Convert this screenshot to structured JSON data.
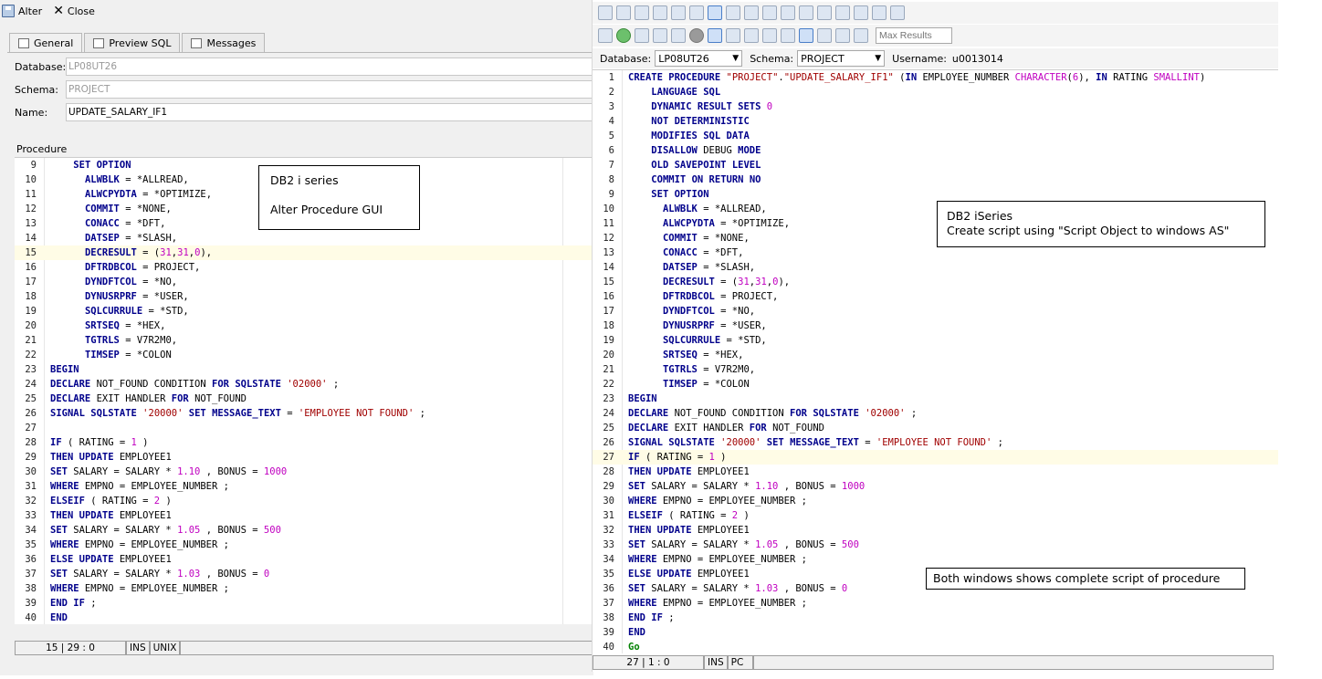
{
  "left": {
    "toolbar": {
      "alter_label": "Alter",
      "close_label": "Close"
    },
    "tabs": [
      "General",
      "Preview SQL",
      "Messages"
    ],
    "fields": {
      "database_label": "Database:",
      "database_value": "LP08UT26",
      "schema_label": "Schema:",
      "schema_value": "PROJECT",
      "name_label": "Name:",
      "name_value": "UPDATE_SALARY_IF1"
    },
    "section_label": "Procedure",
    "code_start_line": 9,
    "highlight_line": 15,
    "status": {
      "position": "15 | 29 : 0",
      "mode": "INS",
      "eol": "UNIX"
    },
    "annotation": {
      "line1": "DB2  i series",
      "line2": "Alter Procedure GUI"
    }
  },
  "right": {
    "max_results_placeholder": "Max Results",
    "database_label": "Database:",
    "database_value": "LP08UT26",
    "schema_label": "Schema:",
    "schema_value": "PROJECT",
    "username_label": "Username:",
    "username_value": "u0013014",
    "code_start_line": 1,
    "highlight_line": 27,
    "status": {
      "position": "27 | 1 : 0",
      "mode": "INS",
      "eol": "PC"
    },
    "annotation1": {
      "line1": "DB2 iSeries",
      "line2": "Create script using \"Script Object to windows AS\""
    },
    "annotation2": {
      "text": "Both windows shows complete script of procedure"
    }
  },
  "left_code": [
    "    <k>SET</k> <k>OPTION</k>",
    "      <k>ALWBLK</k> = *ALLREAD,",
    "      <k>ALWCPYDTA</k> = *OPTIMIZE,",
    "      <k>COMMIT</k> = *NONE,",
    "      <k>CONACC</k> = *DFT,",
    "      <k>DATSEP</k> = *SLASH,",
    "      <k>DECRESULT</k> = (<n>31</n>,<n>31</n>,<n>0</n>),",
    "      <k>DFTRDBCOL</k> = PROJECT,",
    "      <k>DYNDFTCOL</k> = *NO,",
    "      <k>DYNUSRPRF</k> = *USER,",
    "      <k>SQLCURRULE</k> = *STD,",
    "      <k>SRTSEQ</k> = *HEX,",
    "      <k>TGTRLS</k> = V7R2M0,",
    "      <k>TIMSEP</k> = *COLON",
    "<k>BEGIN</k>",
    "<k>DECLARE</k> NOT_FOUND CONDITION <k>FOR</k> <k>SQLSTATE</k> <s>'02000'</s> ;",
    "<k>DECLARE</k> EXIT HANDLER <k>FOR</k> NOT_FOUND",
    "<k>SIGNAL</k> <k>SQLSTATE</k> <s>'20000'</s> <k>SET</k> <k>MESSAGE_TEXT</k> = <s>'EMPLOYEE NOT FOUND'</s> ;",
    "",
    "<k>IF</k> ( RATING = <n>1</n> )",
    "<k>THEN</k> <k>UPDATE</k> EMPLOYEE1",
    "<k>SET</k> SALARY = SALARY * <n>1.10</n> , BONUS = <n>1000</n>",
    "<k>WHERE</k> EMPNO = EMPLOYEE_NUMBER ;",
    "<k>ELSEIF</k> ( RATING = <n>2</n> )",
    "<k>THEN</k> <k>UPDATE</k> EMPLOYEE1",
    "<k>SET</k> SALARY = SALARY * <n>1.05</n> , BONUS = <n>500</n>",
    "<k>WHERE</k> EMPNO = EMPLOYEE_NUMBER ;",
    "<k>ELSE</k> <k>UPDATE</k> EMPLOYEE1",
    "<k>SET</k> SALARY = SALARY * <n>1.03</n> , BONUS = <n>0</n>",
    "<k>WHERE</k> EMPNO = EMPLOYEE_NUMBER ;",
    "<k>END</k> <k>IF</k> ;",
    "<k>END</k>"
  ],
  "right_code": [
    "<k>CREATE</k> <k>PROCEDURE</k> <s>\"PROJECT\"</s>.<s>\"UPDATE_SALARY_IF1\"</s> (<k>IN</k> EMPLOYEE_NUMBER <m>CHARACTER</m>(<n>6</n>), <k>IN</k> RATING <m>SMALLINT</m>)",
    "    <k>LANGUAGE</k> <k>SQL</k>",
    "    <k>DYNAMIC</k> <k>RESULT</k> <k>SETS</k> <n>0</n>",
    "    <k>NOT</k> <k>DETERMINISTIC</k>",
    "    <k>MODIFIES</k> <k>SQL</k> <k>DATA</k>",
    "    <k>DISALLOW</k> DEBUG <k>MODE</k>",
    "    <k>OLD</k> <k>SAVEPOINT</k> <k>LEVEL</k>",
    "    <k>COMMIT</k> <k>ON</k> <k>RETURN</k> <k>NO</k>",
    "    <k>SET</k> <k>OPTION</k>",
    "      <k>ALWBLK</k> = *ALLREAD,",
    "      <k>ALWCPYDTA</k> = *OPTIMIZE,",
    "      <k>COMMIT</k> = *NONE,",
    "      <k>CONACC</k> = *DFT,",
    "      <k>DATSEP</k> = *SLASH,",
    "      <k>DECRESULT</k> = (<n>31</n>,<n>31</n>,<n>0</n>),",
    "      <k>DFTRDBCOL</k> = PROJECT,",
    "      <k>DYNDFTCOL</k> = *NO,",
    "      <k>DYNUSRPRF</k> = *USER,",
    "      <k>SQLCURRULE</k> = *STD,",
    "      <k>SRTSEQ</k> = *HEX,",
    "      <k>TGTRLS</k> = V7R2M0,",
    "      <k>TIMSEP</k> = *COLON",
    "<k>BEGIN</k>",
    "<k>DECLARE</k> NOT_FOUND CONDITION <k>FOR</k> <k>SQLSTATE</k> <s>'02000'</s> ;",
    "<k>DECLARE</k> EXIT HANDLER <k>FOR</k> NOT_FOUND",
    "<k>SIGNAL</k> <k>SQLSTATE</k> <s>'20000'</s> <k>SET</k> <k>MESSAGE_TEXT</k> = <s>'EMPLOYEE NOT FOUND'</s> ;",
    "<k>IF</k> ( RATING = <n>1</n> )",
    "<k>THEN</k> <k>UPDATE</k> EMPLOYEE1",
    "<k>SET</k> SALARY = SALARY * <n>1.10</n> , BONUS = <n>1000</n>",
    "<k>WHERE</k> EMPNO = EMPLOYEE_NUMBER ;",
    "<k>ELSEIF</k> ( RATING = <n>2</n> )",
    "<k>THEN</k> <k>UPDATE</k> EMPLOYEE1",
    "<k>SET</k> SALARY = SALARY * <n>1.05</n> , BONUS = <n>500</n>",
    "<k>WHERE</k> EMPNO = EMPLOYEE_NUMBER ;",
    "<k>ELSE</k> <k>UPDATE</k> EMPLOYEE1",
    "<k>SET</k> SALARY = SALARY * <n>1.03</n> , BONUS = <n>0</n>",
    "<k>WHERE</k> EMPNO = EMPLOYEE_NUMBER ;",
    "<k>END</k> <k>IF</k> ;",
    "<k>END</k>",
    "<g>Go</g>"
  ],
  "colors": {
    "keyword": "#00008b",
    "number": "#c000c0",
    "string": "#a00000",
    "go": "#008000",
    "highlight": "#fffce6"
  }
}
